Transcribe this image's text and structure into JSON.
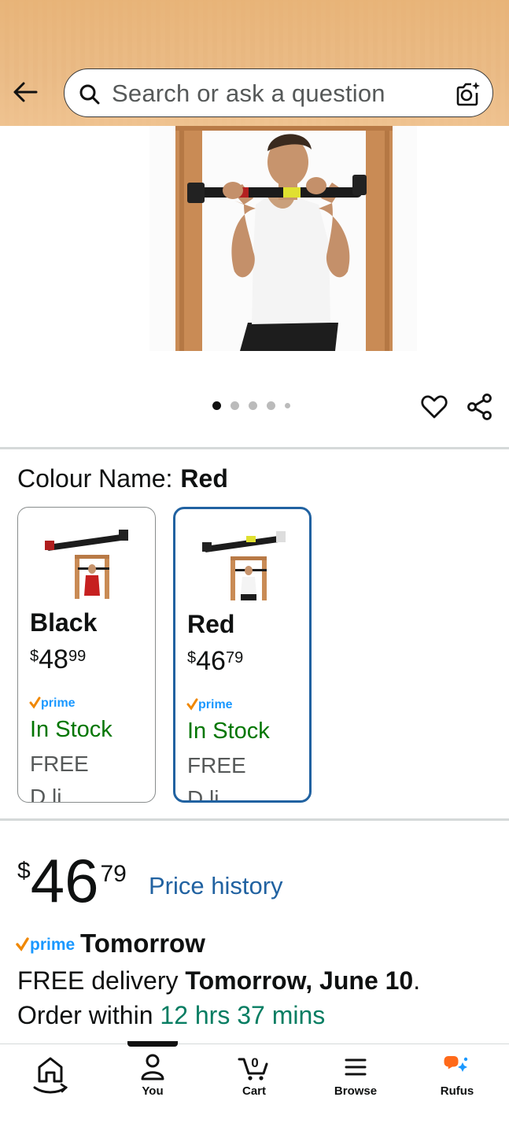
{
  "search": {
    "placeholder": "Search or ask a question"
  },
  "gallery": {
    "image_count": 5,
    "active_index": 0
  },
  "colour": {
    "label": "Colour Name:",
    "selected": "Red"
  },
  "variants": [
    {
      "name": "Black",
      "currency": "$",
      "whole": "48",
      "fraction": "99",
      "prime": "prime",
      "stock": "In Stock",
      "free": "FREE",
      "truncated": "D  li"
    },
    {
      "name": "Red",
      "currency": "$",
      "whole": "46",
      "fraction": "79",
      "prime": "prime",
      "stock": "In Stock",
      "free": "FREE",
      "truncated": "D  li"
    }
  ],
  "price": {
    "currency": "$",
    "whole": "46",
    "fraction": "79",
    "history_link": "Price history"
  },
  "delivery": {
    "prime": "prime",
    "headline": "Tomorrow",
    "line1_prefix": "FREE delivery ",
    "line1_bold": "Tomorrow, June 10",
    "line1_suffix": ".",
    "line2_prefix": "Order within ",
    "line2_countdown": "12 hrs 37 mins"
  },
  "nav": {
    "home": "",
    "you": "You",
    "cart": "Cart",
    "cart_count": "0",
    "browse": "Browse",
    "rufus": "Rufus"
  },
  "colors": {
    "accent_blue": "#2162a1",
    "stock_green": "#007600",
    "countdown_green": "#067d62",
    "prime_blue": "#1a98ff",
    "prime_check": "#f08804"
  }
}
